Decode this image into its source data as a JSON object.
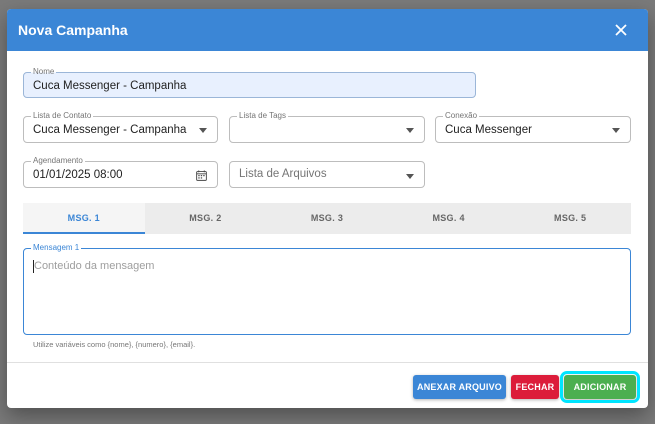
{
  "dialog": {
    "title": "Nova Campanha"
  },
  "form": {
    "nome": {
      "label": "Nome",
      "value": "Cuca Messenger - Campanha"
    },
    "lista_contato": {
      "label": "Lista de Contato",
      "value": "Cuca Messenger - Campanha"
    },
    "lista_tags": {
      "label": "Lista de Tags",
      "value": ""
    },
    "conexao": {
      "label": "Conexão",
      "value": "Cuca Messenger"
    },
    "agendamento": {
      "label": "Agendamento",
      "value": "01/01/2025 08:00"
    },
    "lista_arquivos": {
      "placeholder": "Lista de Arquivos"
    }
  },
  "tabs": [
    {
      "label": "MSG. 1",
      "active": true
    },
    {
      "label": "MSG. 2",
      "active": false
    },
    {
      "label": "MSG. 3",
      "active": false
    },
    {
      "label": "MSG. 4",
      "active": false
    },
    {
      "label": "MSG. 5",
      "active": false
    }
  ],
  "message": {
    "label": "Mensagem 1",
    "placeholder": "Conteúdo da mensagem",
    "helper": "Utilize variáveis como {nome}, {numero}, {email}."
  },
  "actions": {
    "anexar": "ANEXAR ARQUIVO",
    "fechar": "FECHAR",
    "adicionar": "ADICIONAR"
  },
  "colors": {
    "primary": "#3b86d6",
    "danger": "#dc1c3a",
    "success": "#4caf50",
    "highlight": "#00e5ff"
  },
  "icons": {
    "close": "close-icon",
    "calendar": "calendar-icon",
    "dropdown": "chevron-down-icon"
  }
}
